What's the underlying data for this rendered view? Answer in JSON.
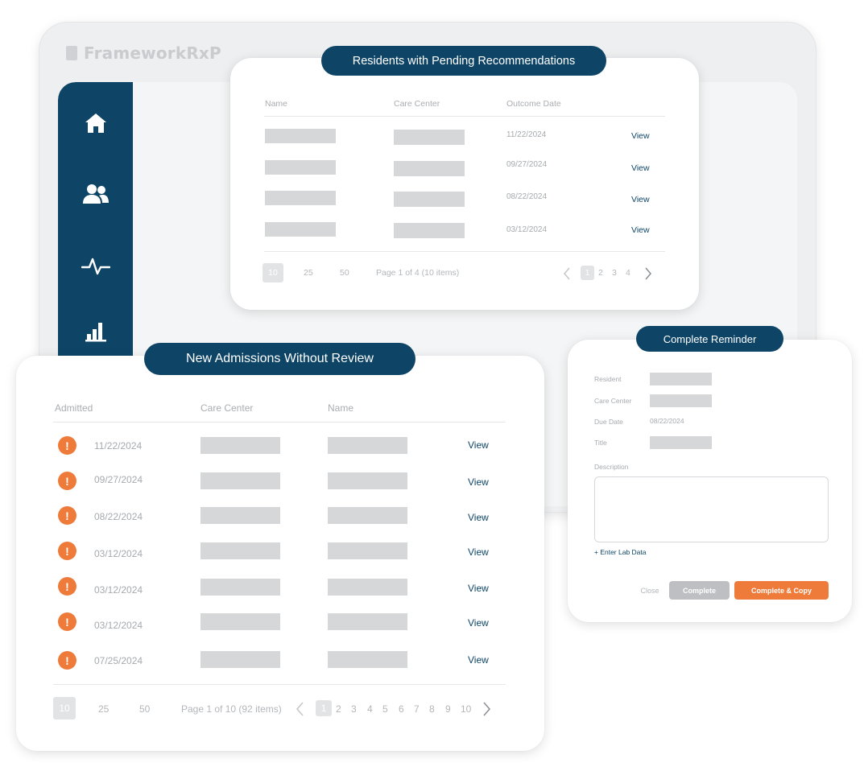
{
  "app": {
    "name": "FrameworkRxP"
  },
  "sidebar": {
    "items": [
      {
        "icon": "home-icon"
      },
      {
        "icon": "users-icon"
      },
      {
        "icon": "activity-icon"
      },
      {
        "icon": "bar-chart-icon"
      }
    ]
  },
  "pending": {
    "title": "Residents with Pending Recommendations",
    "columns": {
      "name": "Name",
      "care_center": "Care Center",
      "outcome_date": "Outcome Date"
    },
    "rows": [
      {
        "date": "11/22/2024",
        "action": "View"
      },
      {
        "date": "09/27/2024",
        "action": "View"
      },
      {
        "date": "08/22/2024",
        "action": "View"
      },
      {
        "date": "03/12/2024",
        "action": "View"
      }
    ],
    "page_sizes": [
      "10",
      "25",
      "50"
    ],
    "page_info": "Page 1 of 4 (10 items)",
    "pages": [
      "1",
      "2",
      "3",
      "4"
    ]
  },
  "admissions": {
    "title": "New Admissions Without Review",
    "columns": {
      "admitted": "Admitted",
      "care_center": "Care Center",
      "name": "Name"
    },
    "alert_glyph": "!",
    "rows": [
      {
        "date": "11/22/2024",
        "action": "View"
      },
      {
        "date": "09/27/2024",
        "action": "View"
      },
      {
        "date": "08/22/2024",
        "action": "View"
      },
      {
        "date": "03/12/2024",
        "action": "View"
      },
      {
        "date": "03/12/2024",
        "action": "View"
      },
      {
        "date": "03/12/2024",
        "action": "View"
      },
      {
        "date": "07/25/2024",
        "action": "View"
      }
    ],
    "page_sizes": [
      "10",
      "25",
      "50"
    ],
    "page_info": "Page 1 of 10 (92 items)",
    "pages": [
      "1",
      "2",
      "3",
      "4",
      "5",
      "6",
      "7",
      "8",
      "9",
      "10"
    ]
  },
  "reminder": {
    "title": "Complete Reminder",
    "labels": {
      "resident": "Resident",
      "care_center": "Care Center",
      "due_date": "Due Date",
      "title": "Title",
      "description": "Description"
    },
    "due_date_value": "08/22/2024",
    "add_lab_link": "+ Enter Lab Data",
    "buttons": {
      "close": "Close",
      "complete": "Complete",
      "complete_copy": "Complete & Copy"
    }
  },
  "colors": {
    "brand_navy": "#0e4566",
    "accent_orange": "#ef7b3a",
    "placeholder_gray": "#d6d7d8",
    "button_gray": "#bdbfc2"
  }
}
